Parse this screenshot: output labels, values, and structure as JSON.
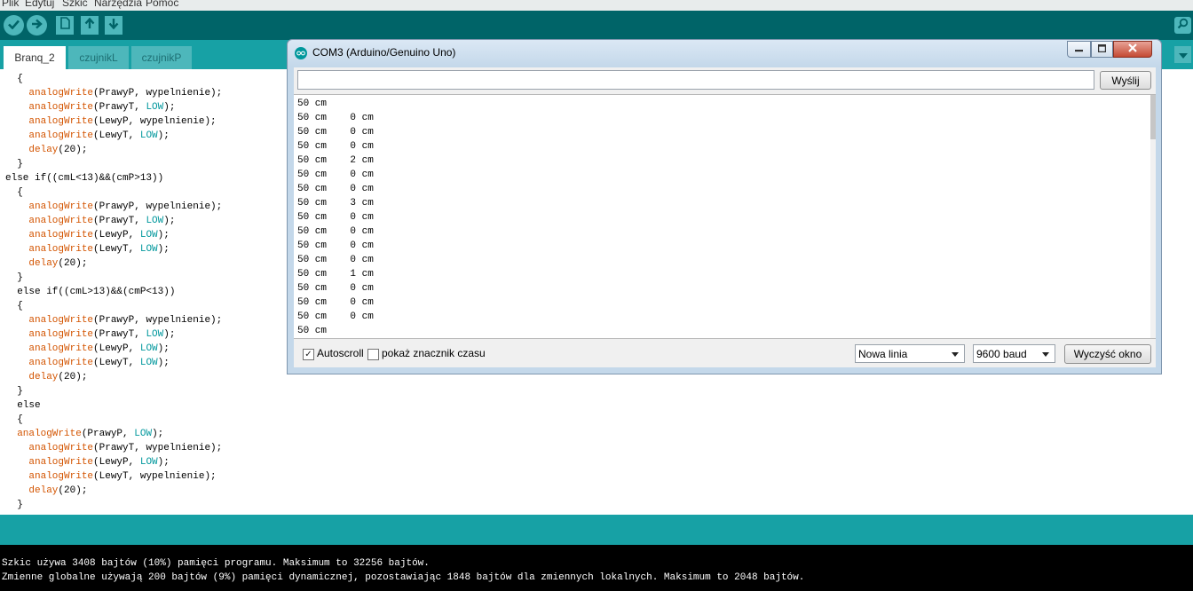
{
  "menu": [
    "Plik",
    "Edytuj",
    "Szkic",
    "Narzędzia",
    "Pomoc"
  ],
  "tabs": [
    "Branq_2",
    "czujnikL",
    "czujnikP"
  ],
  "code": [
    {
      "indent": "  ",
      "tokens": [
        {
          "t": "{",
          "c": "p"
        }
      ]
    },
    {
      "indent": "    ",
      "tokens": [
        {
          "t": "analogWrite",
          "c": "f"
        },
        {
          "t": "(PrawyP, wypelnienie);",
          "c": "p"
        }
      ]
    },
    {
      "indent": "    ",
      "tokens": [
        {
          "t": "analogWrite",
          "c": "f"
        },
        {
          "t": "(PrawyT, ",
          "c": "p"
        },
        {
          "t": "LOW",
          "c": "k"
        },
        {
          "t": ");",
          "c": "p"
        }
      ]
    },
    {
      "indent": "    ",
      "tokens": [
        {
          "t": "analogWrite",
          "c": "f"
        },
        {
          "t": "(LewyP, wypelnienie);",
          "c": "p"
        }
      ]
    },
    {
      "indent": "    ",
      "tokens": [
        {
          "t": "analogWrite",
          "c": "f"
        },
        {
          "t": "(LewyT, ",
          "c": "p"
        },
        {
          "t": "LOW",
          "c": "k"
        },
        {
          "t": ");",
          "c": "p"
        }
      ]
    },
    {
      "indent": "    ",
      "tokens": [
        {
          "t": "delay",
          "c": "f"
        },
        {
          "t": "(20);",
          "c": "p"
        }
      ]
    },
    {
      "indent": "  ",
      "tokens": [
        {
          "t": "}",
          "c": "p"
        }
      ]
    },
    {
      "indent": "",
      "tokens": [
        {
          "t": "else if((cmL<13)&&(cmP>13))",
          "c": "p"
        }
      ]
    },
    {
      "indent": "  ",
      "tokens": [
        {
          "t": "{",
          "c": "p"
        }
      ]
    },
    {
      "indent": "    ",
      "tokens": [
        {
          "t": "analogWrite",
          "c": "f"
        },
        {
          "t": "(PrawyP, wypelnienie);",
          "c": "p"
        }
      ]
    },
    {
      "indent": "    ",
      "tokens": [
        {
          "t": "analogWrite",
          "c": "f"
        },
        {
          "t": "(PrawyT, ",
          "c": "p"
        },
        {
          "t": "LOW",
          "c": "k"
        },
        {
          "t": ");",
          "c": "p"
        }
      ]
    },
    {
      "indent": "    ",
      "tokens": [
        {
          "t": "analogWrite",
          "c": "f"
        },
        {
          "t": "(LewyP, ",
          "c": "p"
        },
        {
          "t": "LOW",
          "c": "k"
        },
        {
          "t": ");",
          "c": "p"
        }
      ]
    },
    {
      "indent": "    ",
      "tokens": [
        {
          "t": "analogWrite",
          "c": "f"
        },
        {
          "t": "(LewyT, ",
          "c": "p"
        },
        {
          "t": "LOW",
          "c": "k"
        },
        {
          "t": ");",
          "c": "p"
        }
      ]
    },
    {
      "indent": "    ",
      "tokens": [
        {
          "t": "delay",
          "c": "f"
        },
        {
          "t": "(20);",
          "c": "p"
        }
      ]
    },
    {
      "indent": "  ",
      "tokens": [
        {
          "t": "}",
          "c": "p"
        }
      ]
    },
    {
      "indent": "  ",
      "tokens": [
        {
          "t": "else if((cmL>13)&&(cmP<13))",
          "c": "p"
        }
      ]
    },
    {
      "indent": "  ",
      "tokens": [
        {
          "t": "{",
          "c": "p"
        }
      ]
    },
    {
      "indent": "    ",
      "tokens": [
        {
          "t": "analogWrite",
          "c": "f"
        },
        {
          "t": "(PrawyP, wypelnienie);",
          "c": "p"
        }
      ]
    },
    {
      "indent": "    ",
      "tokens": [
        {
          "t": "analogWrite",
          "c": "f"
        },
        {
          "t": "(PrawyT, ",
          "c": "p"
        },
        {
          "t": "LOW",
          "c": "k"
        },
        {
          "t": ");",
          "c": "p"
        }
      ]
    },
    {
      "indent": "    ",
      "tokens": [
        {
          "t": "analogWrite",
          "c": "f"
        },
        {
          "t": "(LewyP, ",
          "c": "p"
        },
        {
          "t": "LOW",
          "c": "k"
        },
        {
          "t": ");",
          "c": "p"
        }
      ]
    },
    {
      "indent": "    ",
      "tokens": [
        {
          "t": "analogWrite",
          "c": "f"
        },
        {
          "t": "(LewyT, ",
          "c": "p"
        },
        {
          "t": "LOW",
          "c": "k"
        },
        {
          "t": ");",
          "c": "p"
        }
      ]
    },
    {
      "indent": "    ",
      "tokens": [
        {
          "t": "delay",
          "c": "f"
        },
        {
          "t": "(20);",
          "c": "p"
        }
      ]
    },
    {
      "indent": "  ",
      "tokens": [
        {
          "t": "}",
          "c": "p"
        }
      ]
    },
    {
      "indent": "  ",
      "tokens": [
        {
          "t": "else",
          "c": "p"
        }
      ]
    },
    {
      "indent": "  ",
      "tokens": [
        {
          "t": "{",
          "c": "p"
        }
      ]
    },
    {
      "indent": "  ",
      "tokens": [
        {
          "t": "analogWrite",
          "c": "f"
        },
        {
          "t": "(PrawyP, ",
          "c": "p"
        },
        {
          "t": "LOW",
          "c": "k"
        },
        {
          "t": ");",
          "c": "p"
        }
      ]
    },
    {
      "indent": "    ",
      "tokens": [
        {
          "t": "analogWrite",
          "c": "f"
        },
        {
          "t": "(PrawyT, wypelnienie);",
          "c": "p"
        }
      ]
    },
    {
      "indent": "    ",
      "tokens": [
        {
          "t": "analogWrite",
          "c": "f"
        },
        {
          "t": "(LewyP, ",
          "c": "p"
        },
        {
          "t": "LOW",
          "c": "k"
        },
        {
          "t": ");",
          "c": "p"
        }
      ]
    },
    {
      "indent": "    ",
      "tokens": [
        {
          "t": "analogWrite",
          "c": "f"
        },
        {
          "t": "(LewyT, wypelnienie);",
          "c": "p"
        }
      ]
    },
    {
      "indent": "    ",
      "tokens": [
        {
          "t": "delay",
          "c": "f"
        },
        {
          "t": "(20);",
          "c": "p"
        }
      ]
    },
    {
      "indent": "  ",
      "tokens": [
        {
          "t": "}",
          "c": "p"
        }
      ]
    }
  ],
  "console": [
    "Szkic używa 3408 bajtów (10%) pamięci programu. Maksimum to 32256 bajtów.",
    "Zmienne globalne używają 200 bajtów (9%) pamięci dynamicznej, pozostawiając 1848 bajtów dla zmiennych lokalnych. Maksimum to 2048 bajtów."
  ],
  "serial": {
    "title": "COM3 (Arduino/Genuino Uno)",
    "send_label": "Wyślij",
    "input_value": "",
    "output": [
      "50 cm",
      "50 cm    0 cm",
      "50 cm    0 cm",
      "50 cm    0 cm",
      "50 cm    2 cm",
      "50 cm    0 cm",
      "50 cm    0 cm",
      "50 cm    3 cm",
      "50 cm    0 cm",
      "50 cm    0 cm",
      "50 cm    0 cm",
      "50 cm    0 cm",
      "50 cm    1 cm",
      "50 cm    0 cm",
      "50 cm    0 cm",
      "50 cm    0 cm",
      "50 cm"
    ],
    "autoscroll_label": "Autoscroll",
    "autoscroll_checked": true,
    "timestamp_label": "pokaż znacznik czasu",
    "timestamp_checked": false,
    "line_ending": "Nowa linia",
    "baud": "9600 baud",
    "clear_label": "Wyczyść okno"
  },
  "colors": {
    "toolbar": "#006468",
    "tabbar": "#17a1a5",
    "button": "#4db7bb",
    "code_function": "#d35400",
    "code_constant": "#00979c"
  }
}
